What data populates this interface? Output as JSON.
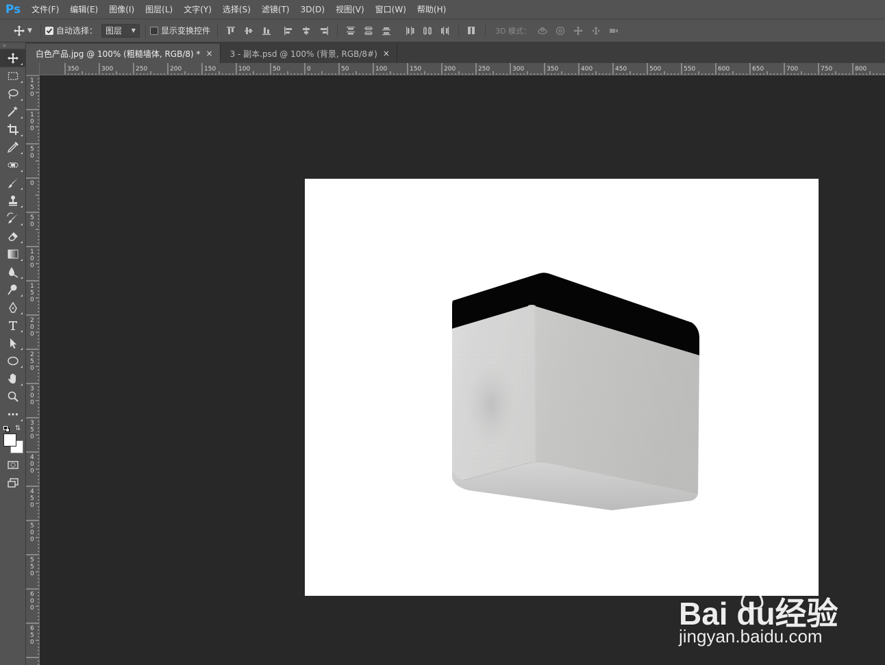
{
  "app": {
    "logo": "Ps"
  },
  "menu": [
    "文件(F)",
    "编辑(E)",
    "图像(I)",
    "图层(L)",
    "文字(Y)",
    "选择(S)",
    "滤镜(T)",
    "3D(D)",
    "视图(V)",
    "窗口(W)",
    "帮助(H)"
  ],
  "options": {
    "auto_select_label": "自动选择：",
    "auto_select_checked": true,
    "auto_select_target": "图层",
    "show_transform_label": "显示变换控件",
    "show_transform_checked": false,
    "mode3d_label": "3D 模式："
  },
  "tabs": [
    {
      "label": "白色产品.jpg @ 100% (粗糙墙体, RGB/8) *",
      "active": true,
      "close": "×"
    },
    {
      "label": "3 - 副本.psd @ 100% (背景, RGB/8#)",
      "active": false,
      "close": "×"
    }
  ],
  "ruler": {
    "top_labels": [
      "350",
      "300",
      "250",
      "200",
      "150",
      "100",
      "50",
      "0",
      "50",
      "100",
      "150",
      "200",
      "250",
      "300",
      "350",
      "400",
      "450",
      "500",
      "550",
      "600",
      "650",
      "700",
      "750",
      "800"
    ],
    "left_labels": [
      "150",
      "100",
      "50",
      "0",
      "50",
      "100",
      "150",
      "200",
      "250",
      "300",
      "350",
      "400",
      "450",
      "500",
      "550",
      "600",
      "650"
    ]
  },
  "tools": [
    "move-tool",
    "marquee-tool",
    "lasso-tool",
    "magic-wand-tool",
    "crop-tool",
    "eyedropper-tool",
    "healing-brush-tool",
    "brush-tool",
    "clone-stamp-tool",
    "history-brush-tool",
    "eraser-tool",
    "gradient-tool",
    "blur-tool",
    "dodge-tool",
    "pen-tool",
    "type-tool",
    "path-selection-tool",
    "ellipse-tool",
    "hand-tool",
    "zoom-tool",
    "more-tools"
  ],
  "colors": {
    "foreground": "#ffffff",
    "background": "#ffffff",
    "accent": "#31a8ff"
  },
  "watermark": {
    "brand": "Bai du经验",
    "url": "jingyan.baidu.com"
  }
}
